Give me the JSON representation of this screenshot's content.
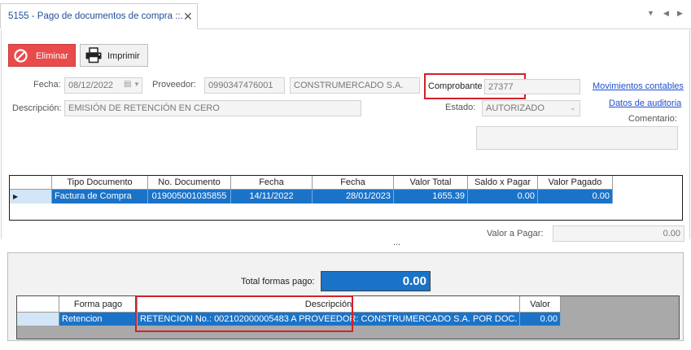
{
  "tab": {
    "title": "5155 - Pago de documentos de compra ::."
  },
  "toolbar": {
    "delete_label": "Eliminar",
    "print_label": "Imprimir"
  },
  "form": {
    "fecha_label": "Fecha:",
    "fecha_value": "08/12/2022",
    "proveedor_label": "Proveedor:",
    "proveedor_ruc": "0990347476001",
    "proveedor_name": "CONSTRUMERCADO S.A.",
    "comprobante_label": "Comprobante",
    "comprobante_value": "27377",
    "descripcion_label": "Descripción:",
    "descripcion_value": "EMISIÓN DE RETENCIÓN EN CERO",
    "estado_label": "Estado:",
    "estado_value": "AUTORIZADO",
    "comentario_label": "Comentario:",
    "link_movimientos": "Movimientos contables",
    "link_auditoria": "Datos de auditoria"
  },
  "documents_grid": {
    "headers": [
      "Tipo Documento",
      "No. Documento",
      "Fecha",
      "Fecha",
      "Valor Total",
      "Saldo x Pagar",
      "Valor Pagado"
    ],
    "rows": [
      [
        "Factura de Compra",
        "019005001035855",
        "14/11/2022",
        "28/01/2023",
        "1655.39",
        "0.00",
        "0.00"
      ]
    ]
  },
  "valor_pagar": {
    "label": "Valor a Pagar:",
    "value": "0.00"
  },
  "splitter": "...",
  "payments": {
    "total_label": "Total formas pago:",
    "total_value": "0.00",
    "headers": [
      "Forma pago",
      "Descripción",
      "Valor"
    ],
    "rows": [
      [
        "Retencion",
        "RETENCION No.: 002102000005483 A PROVEEDOR: CONSTRUMERCADO S.A. POR DOC. C...",
        "0.00"
      ]
    ]
  },
  "colors": {
    "accent": "#1b73c8",
    "danger": "#e94b4b",
    "highlight": "#d4202a"
  }
}
